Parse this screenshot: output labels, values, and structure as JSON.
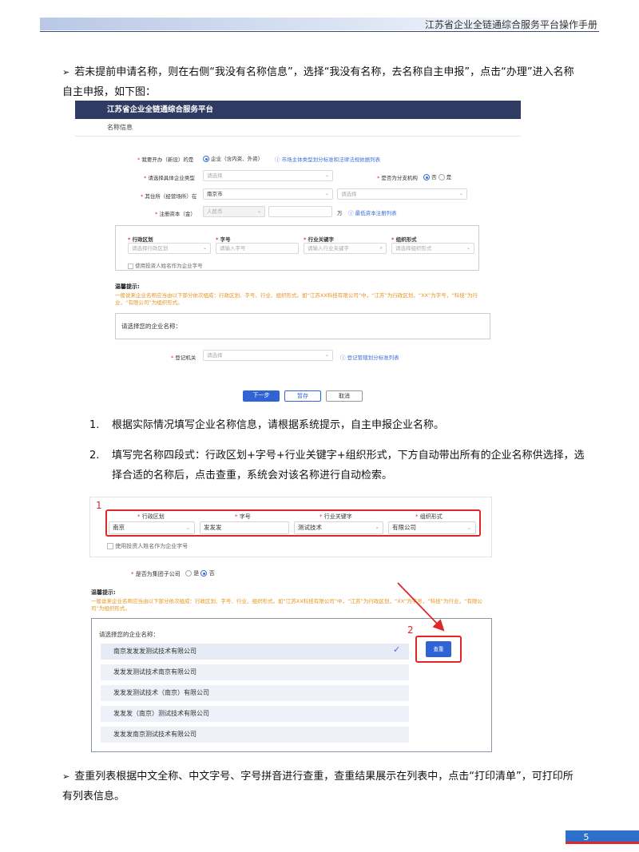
{
  "header": {
    "title": "江苏省企业全链通综合服务平台操作手册"
  },
  "intro": {
    "bullet": "➢",
    "text": "若未提前申请名称，则在右侧“我没有名称信息”，选择“我没有名称，去名称自主申报”，点击“办理”进入名称自主申报，如下图："
  },
  "shot1": {
    "platform_title": "江苏省企业全链通综合服务平台",
    "section_title": "名称信息",
    "row1": {
      "label": "我要开办（新设）的是",
      "option": "企业（含内资、外资）",
      "link": "市场主体类型划分标准和法律法规依据列表"
    },
    "row2": {
      "label": "请选择具体企业类型",
      "placeholder": "请选择",
      "branch_label": "是否为分支机构",
      "opt_no": "否",
      "opt_yes": "是"
    },
    "row3": {
      "label": "其住所（经营场所）在",
      "value": "南京市",
      "placeholder": "请选择"
    },
    "row4": {
      "label": "注册资本（金）",
      "currency": "人民币",
      "unit": "万",
      "link": "最低资本注册列表"
    },
    "name_parts": {
      "district_label": "行政区划",
      "district_placeholder": "请选择行政区划",
      "trade_label": "字号",
      "trade_placeholder": "请输入字号",
      "industry_label": "行业关键字",
      "industry_placeholder": "请输入行业关键字",
      "org_label": "组织形式",
      "org_placeholder": "请选择组织形式",
      "investor_checkbox": "使用投资人姓名作为企业字号"
    },
    "tip_title": "温馨提示:",
    "tip_text": "一般说来企业名称应当由以下部分依次组成：行政区划、字号、行业、组织形式。如“江苏XX科技有限公司”中，“江苏”为行政区划，“XX”为字号，“科技”为行业，“有限公司”为组织形式。",
    "choose_label": "请选择您的企业名称：",
    "reg_label": "登记机关",
    "reg_placeholder": "请选择",
    "reg_link": "登记管辖划分标准列表",
    "btn_next": "下一步",
    "btn_save": "暂存",
    "btn_cancel": "取消"
  },
  "steps": [
    {
      "num": "1.",
      "text": "根据实际情况填写企业名称信息，请根据系统提示，自主申报企业名称。"
    },
    {
      "num": "2.",
      "text": "填写完名称四段式：行政区划+字号+行业关键字+组织形式，下方自动带出所有的企业名称供选择，选择合适的名称后，点击查重，系统会对该名称进行自动检索。"
    }
  ],
  "shot2": {
    "marker1": "1",
    "marker2": "2",
    "district_label": "行政区划",
    "district_value": "南京",
    "trade_label": "字号",
    "trade_value": "发发发",
    "industry_label": "行业关键字",
    "industry_value": "测试技术",
    "org_label": "组织形式",
    "org_value": "有限公司",
    "investor_checkbox": "使用投资人姓名作为企业字号",
    "group_label": "是否为集团子公司",
    "opt_yes": "是",
    "opt_no": "否",
    "tip_title": "温馨提示:",
    "tip_text": "一般说来企业名称应当由以下部分依次组成：行政区划、字号、行业、组织形式。如“江苏XX科技有限公司”中，“江苏”为行政区划，“XX”为字号，“科技”为行业，“有限公司”为组织形式。",
    "choose_label": "请选择您的企业名称：",
    "names": [
      "南京发发发测试技术有限公司",
      "发发发测试技术南京有限公司",
      "发发发测试技术（南京）有限公司",
      "发发发（南京）测试技术有限公司",
      "发发发南京测试技术有限公司"
    ],
    "query_button": "查重"
  },
  "outro": {
    "bullet": "➢",
    "text": "查重列表根据中文全称、中文字号、字号拼音进行查重，查重结果展示在列表中，点击“打印清单”，可打印所有列表信息。"
  },
  "page_number": "5",
  "colors": {
    "brand_dark": "#2f3b63",
    "accent_blue": "#3063d6",
    "highlight_red": "#e02727",
    "tip_orange": "#e8931a"
  }
}
